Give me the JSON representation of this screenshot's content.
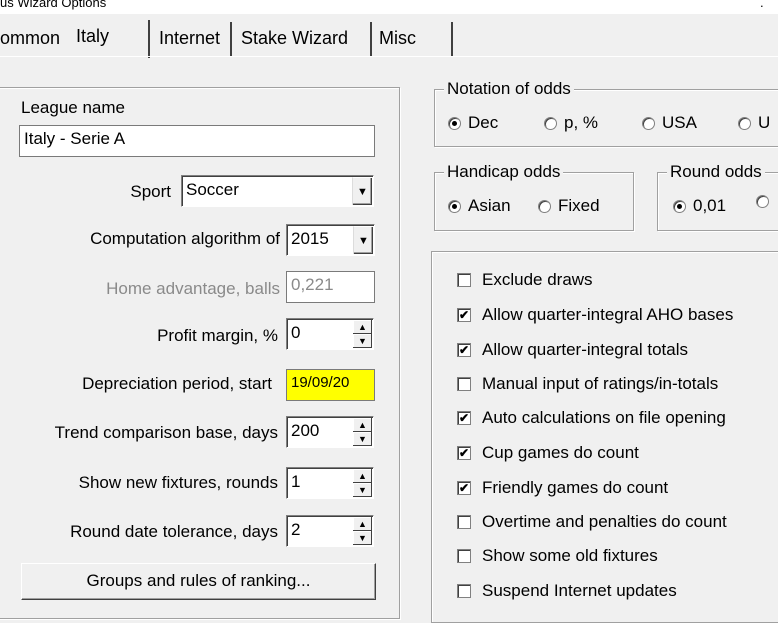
{
  "window": {
    "title": "us Wizard Options",
    "title_right": "."
  },
  "tabs": [
    {
      "label": "ommon"
    },
    {
      "label": "Italy"
    },
    {
      "label": "Internet"
    },
    {
      "label": "Stake Wizard"
    },
    {
      "label": "Misc"
    }
  ],
  "league": {
    "name_label": "League name",
    "name_value": "Italy - Serie A",
    "sport_label": "Sport",
    "sport_value": "Soccer",
    "algorithm_label": "Computation algorithm of",
    "algorithm_value": "2015",
    "home_adv_label": "Home advantage, balls",
    "home_adv_value": "0,221",
    "profit_label": "Profit margin, %",
    "profit_value": "0",
    "depreciation_label": "Depreciation period, start",
    "depreciation_value": "19/09/20",
    "trend_label": "Trend comparison base, days",
    "trend_value": "200",
    "fixtures_label": "Show new fixtures, rounds",
    "fixtures_value": "1",
    "tolerance_label": "Round date tolerance, days",
    "tolerance_value": "2",
    "groups_button": "Groups and rules of ranking..."
  },
  "odds_notation": {
    "legend": "Notation of odds",
    "options": [
      {
        "label": "Dec",
        "selected": true
      },
      {
        "label": "p, %",
        "selected": false
      },
      {
        "label": "USA",
        "selected": false
      },
      {
        "label": "U",
        "selected": false
      }
    ]
  },
  "handicap": {
    "legend": "Handicap odds",
    "options": [
      {
        "label": "Asian",
        "selected": true
      },
      {
        "label": "Fixed",
        "selected": false
      }
    ]
  },
  "round_odds": {
    "legend": "Round odds",
    "options": [
      {
        "label": "0,01",
        "selected": true
      },
      {
        "label": "",
        "selected": false
      }
    ]
  },
  "checkboxes": [
    {
      "label": "Exclude draws",
      "checked": false
    },
    {
      "label": "Allow quarter-integral AHO bases",
      "checked": true
    },
    {
      "label": "Allow quarter-integral totals",
      "checked": true
    },
    {
      "label": "Manual input of ratings/in-totals",
      "checked": false
    },
    {
      "label": "Auto calculations on file opening",
      "checked": true
    },
    {
      "label": "Cup games do count",
      "checked": true
    },
    {
      "label": "Friendly games do count",
      "checked": true
    },
    {
      "label": "Overtime and penalties do count",
      "checked": false
    },
    {
      "label": "Show some old fixtures",
      "checked": false
    },
    {
      "label": "Suspend Internet updates",
      "checked": false
    }
  ],
  "icons": {
    "dropdown": "chevron-down-icon",
    "spin_up": "spin-up-icon",
    "spin_down": "spin-down-icon"
  }
}
